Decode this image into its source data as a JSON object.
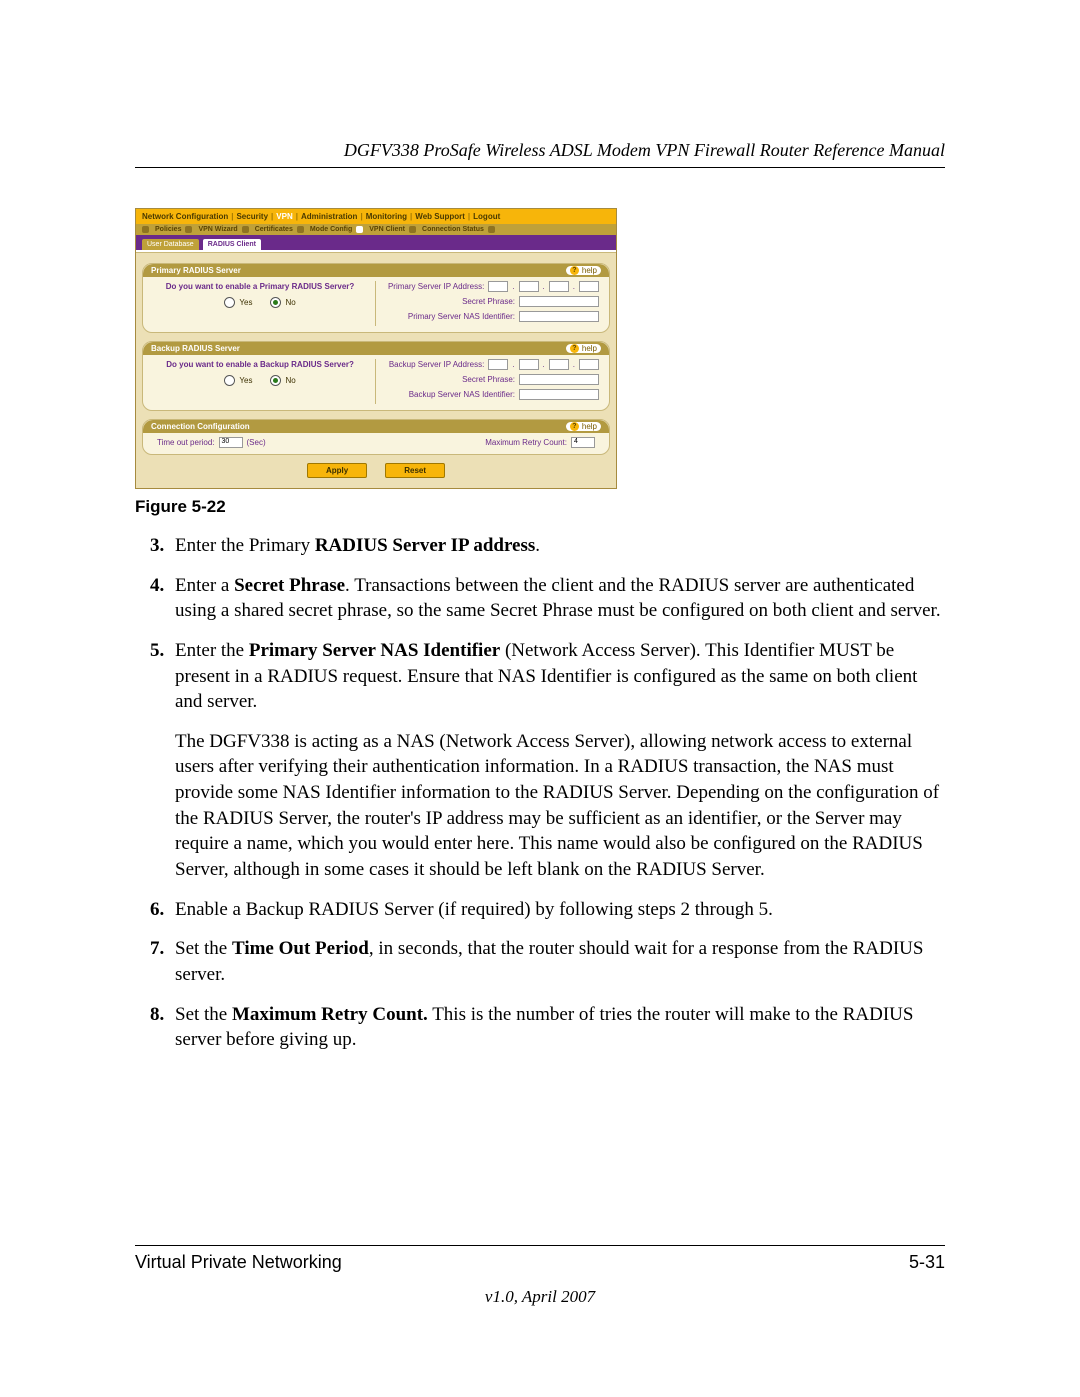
{
  "header_title": "DGFV338 ProSafe Wireless ADSL Modem VPN Firewall Router Reference Manual",
  "router": {
    "nav_main": [
      "Network Configuration",
      "Security",
      "VPN",
      "Administration",
      "Monitoring",
      "Web Support",
      "Logout"
    ],
    "nav_sub": [
      "Policies",
      "VPN Wizard",
      "Certificates",
      "Mode Config",
      "VPN Client",
      "Connection Status"
    ],
    "tabs": {
      "user_db": "User Database",
      "radius": "RADIUS Client"
    },
    "help_label": "help",
    "primary": {
      "title": "Primary RADIUS Server",
      "question": "Do you want to enable a Primary RADIUS Server?",
      "yes": "Yes",
      "no": "No",
      "ip_label": "Primary Server IP Address:",
      "secret_label": "Secret Phrase:",
      "nas_label": "Primary Server NAS Identifier:"
    },
    "backup": {
      "title": "Backup RADIUS Server",
      "question": "Do you want to enable a Backup RADIUS Server?",
      "yes": "Yes",
      "no": "No",
      "ip_label": "Backup Server IP Address:",
      "secret_label": "Secret Phrase:",
      "nas_label": "Backup Server NAS Identifier:"
    },
    "conn": {
      "title": "Connection Configuration",
      "timeout_label": "Time out period:",
      "timeout_value": "30",
      "timeout_unit": "(Sec)",
      "retry_label": "Maximum Retry Count:",
      "retry_value": "4"
    },
    "apply": "Apply",
    "reset": "Reset"
  },
  "figure_caption": "Figure 5-22",
  "steps": {
    "3_pre": "Enter the Primary ",
    "3_bold": "RADIUS Server IP address",
    "3_post": ".",
    "4_pre": "Enter a ",
    "4_bold": "Secret Phrase",
    "4_post": ". Transactions between the client and the RADIUS server are authenticated using a shared secret phrase, so the same Secret Phrase must be configured on both client and server.",
    "5_pre": "Enter the ",
    "5_bold": "Primary Server NAS Identifier",
    "5_post": " (Network Access Server). This Identifier MUST be present in a RADIUS request. Ensure that NAS Identifier is configured as the same on both client and server.",
    "5_extra": "The DGFV338 is acting as a NAS (Network Access Server), allowing network access to external users after verifying their authentication information. In a RADIUS transaction, the NAS must provide some NAS Identifier information to the RADIUS Server. Depending on the configuration of the RADIUS Server, the router's IP address may be sufficient as an identifier, or the Server may require a name, which you would enter here. This name would also be configured on the RADIUS Server, although in some cases it should be left blank on the RADIUS Server.",
    "6": "Enable a Backup RADIUS Server (if required) by following steps 2 through 5.",
    "7_pre": "Set the ",
    "7_bold": "Time Out Period",
    "7_post": ", in seconds, that the router should wait for a response from the RADIUS server.",
    "8_pre": "Set the ",
    "8_bold": "Maximum Retry Count.",
    "8_post": " This is the number of tries the router will make to the RADIUS server before giving up."
  },
  "footer_left": "Virtual Private Networking",
  "footer_right": "5-31",
  "footer_version": "v1.0, April 2007"
}
